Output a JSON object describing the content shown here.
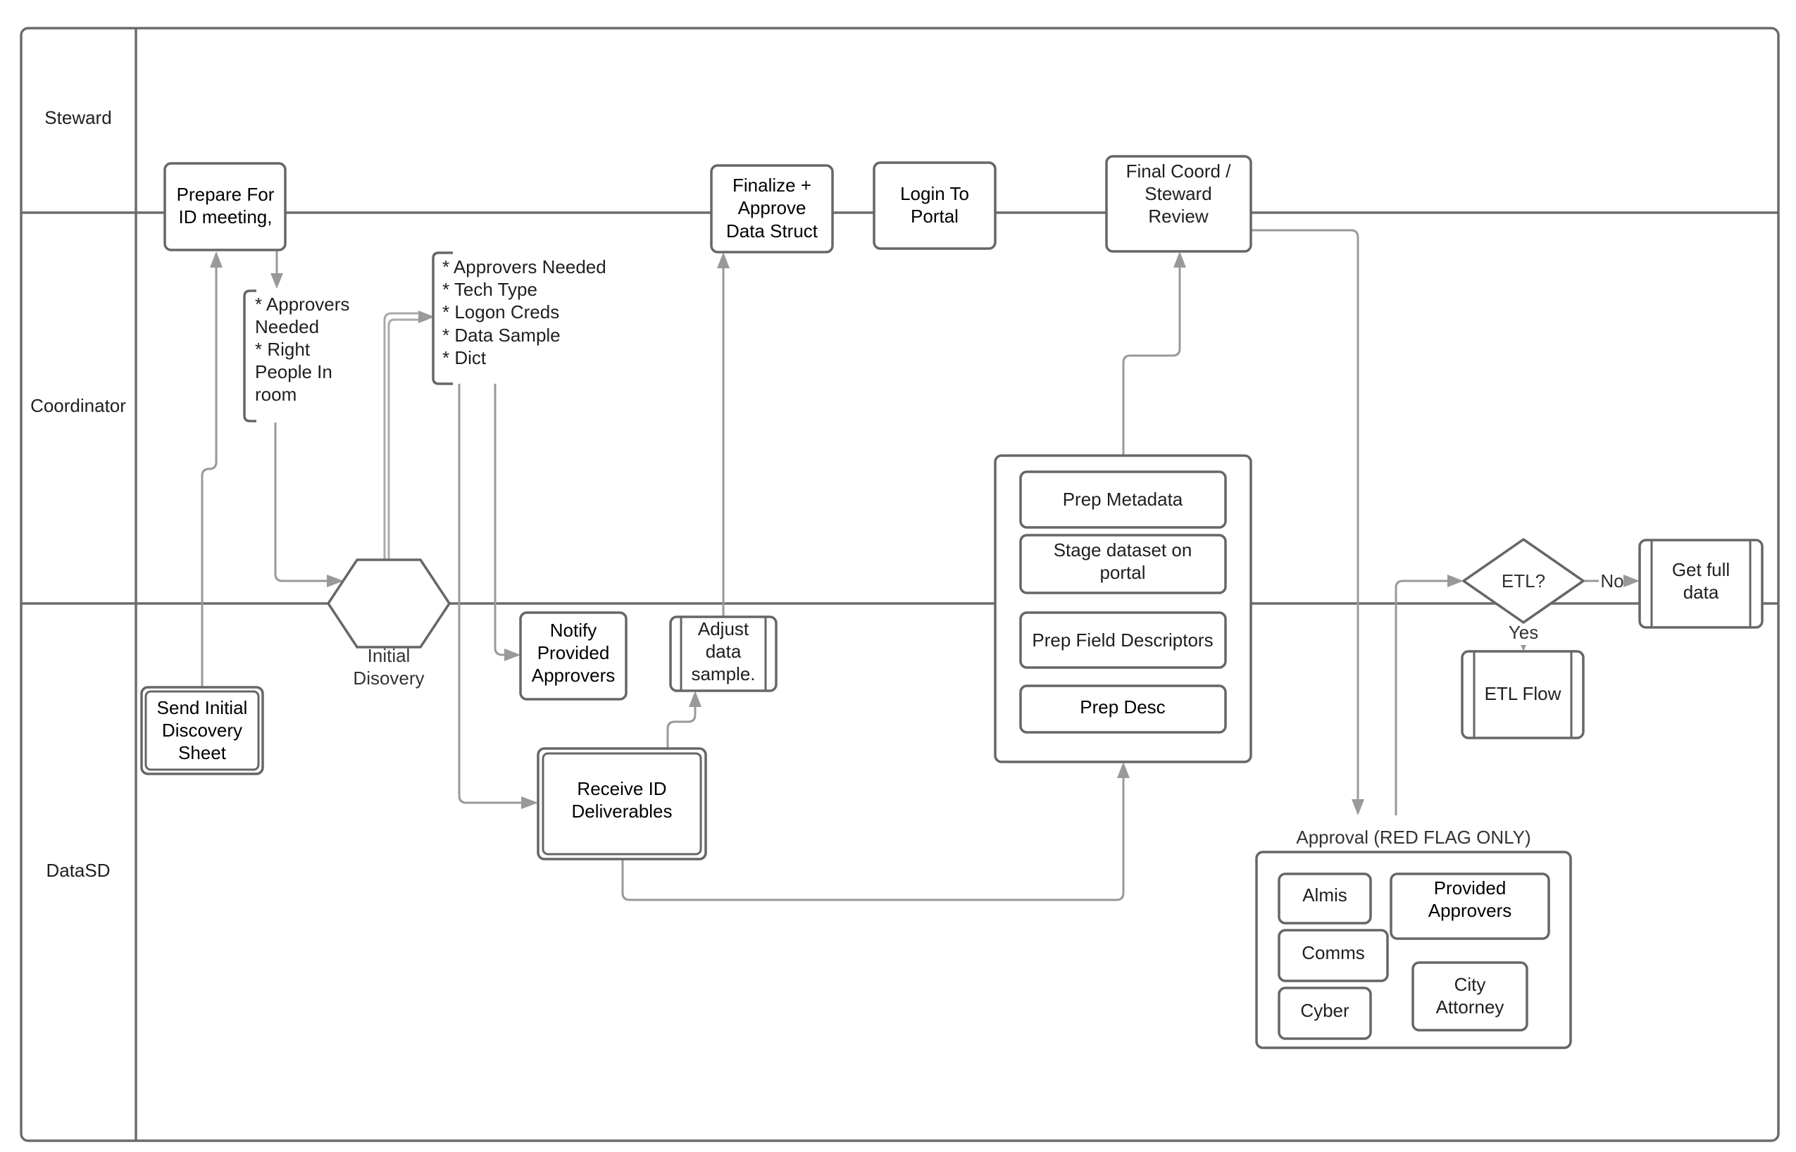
{
  "diagram": {
    "type": "swimlane-flowchart",
    "lanes": [
      {
        "label": "Steward"
      },
      {
        "label": "Coordinator"
      },
      {
        "label": "DataSD"
      }
    ],
    "nodes": {
      "prepare": {
        "lines": [
          "Prepare For",
          "ID meeting,"
        ]
      },
      "finalize": {
        "lines": [
          "Finalize +",
          "Approve",
          "Data Struct"
        ]
      },
      "login": {
        "lines": [
          "Login To",
          "Portal"
        ]
      },
      "final_review": {
        "lines": [
          "Final Coord /",
          "Steward",
          "Review"
        ]
      },
      "note_meeting": {
        "lines": [
          "* Approvers",
          "Needed",
          "* Right",
          "People In",
          "room"
        ]
      },
      "note_discovery": {
        "lines": [
          "* Approvers Needed",
          "* Tech Type",
          "* Logon Creds",
          "* Data Sample",
          "* Dict"
        ]
      },
      "initial_discovery": {
        "lines": [
          "Initial",
          "Disovery"
        ]
      },
      "notify": {
        "lines": [
          "Notify",
          "Provided",
          "Approvers"
        ]
      },
      "adjust": {
        "lines": [
          "Adjust",
          "data",
          "sample."
        ]
      },
      "receive": {
        "lines": [
          "Receive ID",
          "Deliverables"
        ]
      },
      "send_sheet": {
        "lines": [
          "Send Initial",
          "Discovery",
          "Sheet"
        ]
      },
      "prep_metadata": {
        "lines": [
          "Prep Metadata"
        ]
      },
      "stage_dataset": {
        "lines": [
          "Stage dataset on",
          "portal"
        ]
      },
      "prep_field": {
        "lines": [
          "Prep Field Descriptors"
        ]
      },
      "prep_desc": {
        "lines": [
          "Prep Desc"
        ]
      },
      "etl_decision": {
        "lines": [
          "ETL?"
        ]
      },
      "get_full_data": {
        "lines": [
          "Get full",
          "data"
        ]
      },
      "etl_flow": {
        "lines": [
          "ETL Flow"
        ]
      },
      "approval_group": {
        "title": "Approval (RED FLAG ONLY)"
      },
      "almis": {
        "lines": [
          "Almis"
        ]
      },
      "provided_approvers": {
        "lines": [
          "Provided",
          "Approvers"
        ]
      },
      "comms": {
        "lines": [
          "Comms"
        ]
      },
      "city_attorney": {
        "lines": [
          "City",
          "Attorney"
        ]
      },
      "cyber": {
        "lines": [
          "Cyber"
        ]
      }
    },
    "edge_labels": {
      "no": "No",
      "yes": "Yes"
    },
    "edges": [
      {
        "from": "send_sheet",
        "to": "prepare"
      },
      {
        "from": "prepare",
        "to": "note_meeting"
      },
      {
        "from": "note_meeting",
        "to": "initial_discovery"
      },
      {
        "from": "initial_discovery",
        "to": "note_discovery"
      },
      {
        "from": "note_discovery",
        "to": "notify"
      },
      {
        "from": "note_discovery",
        "to": "receive"
      },
      {
        "from": "receive",
        "to": "adjust"
      },
      {
        "from": "adjust",
        "to": "finalize"
      },
      {
        "from": "receive",
        "to": "prep_container"
      },
      {
        "from": "prep_container",
        "to": "final_review"
      },
      {
        "from": "final_review",
        "to": "approval_group"
      },
      {
        "from": "approval_group",
        "to": "etl_decision"
      },
      {
        "from": "etl_decision",
        "to": "get_full_data",
        "label": "No"
      },
      {
        "from": "etl_decision",
        "to": "etl_flow",
        "label": "Yes"
      }
    ]
  }
}
